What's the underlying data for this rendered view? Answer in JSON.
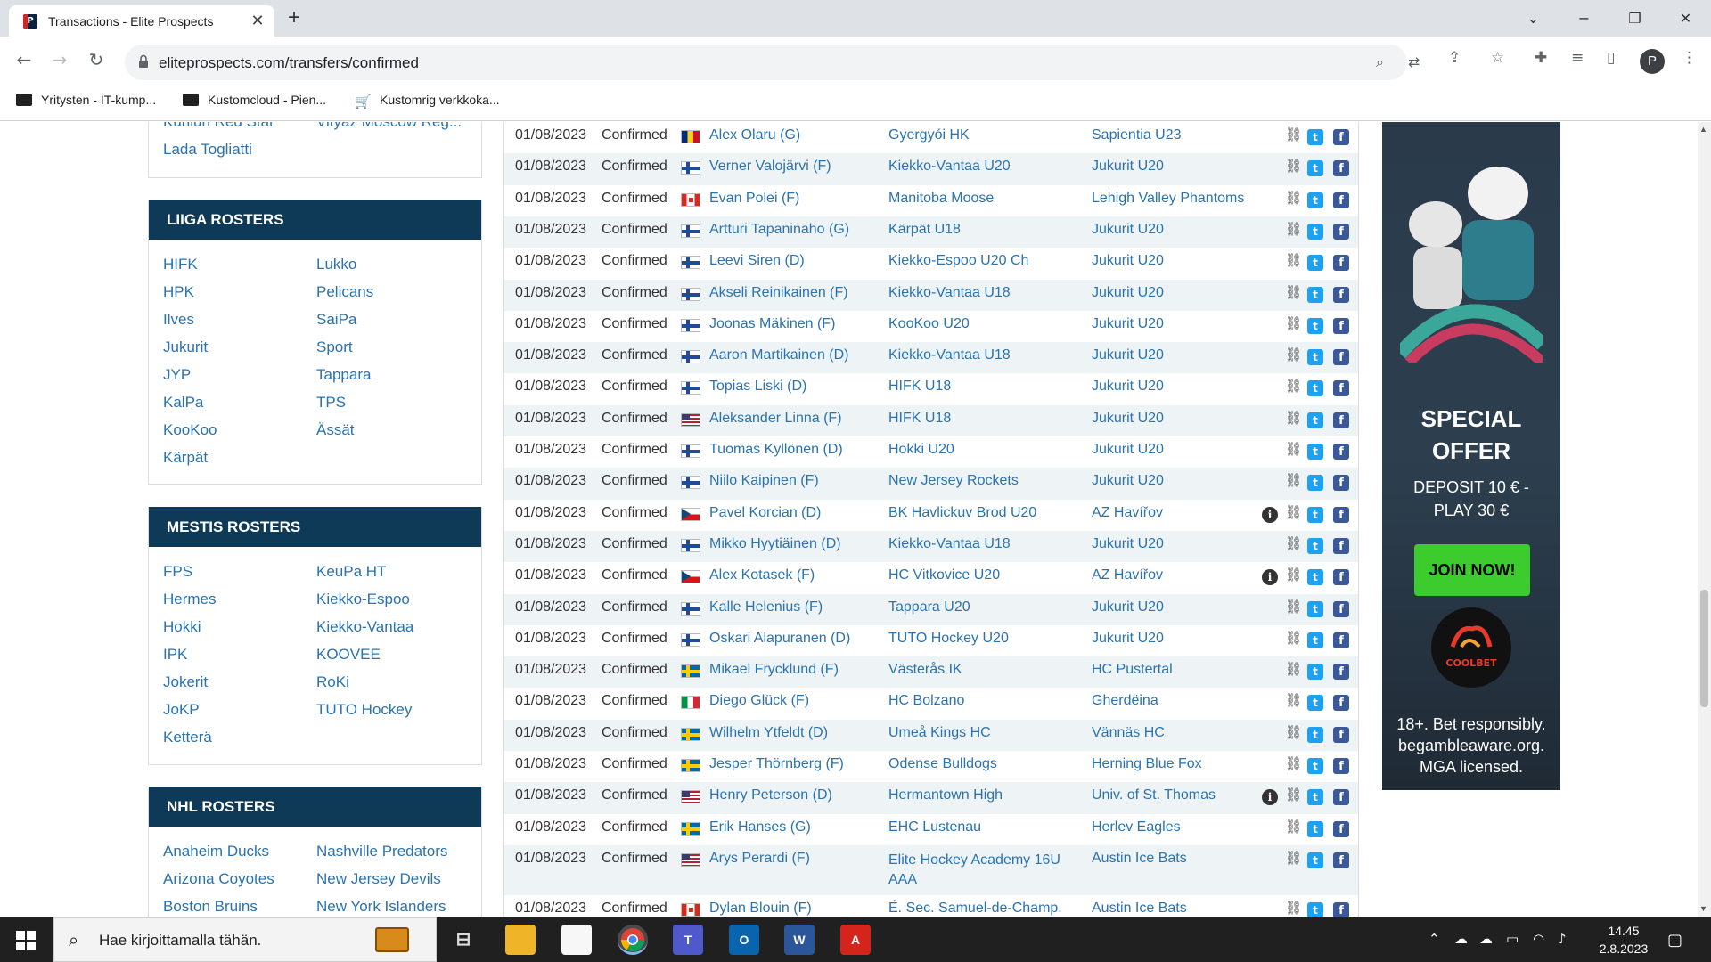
{
  "browser": {
    "tab_title": "Transactions - Elite Prospects",
    "tab_close": "✕",
    "new_tab": "+",
    "url": "eliteprospects.com/transfers/confirmed",
    "win_minimize": "⌄",
    "win_restore": "−",
    "win_maximize": "❐",
    "win_close": "✕",
    "profile_initial": "P",
    "bookmarks": [
      {
        "label": "Yritysten - IT-kump..."
      },
      {
        "label": "Kustomcloud - Pien..."
      },
      {
        "label": "Kustomrig verkkoka..."
      }
    ]
  },
  "sidebar": {
    "khl_partial": {
      "left": [
        "Kunlun Red Star",
        "Lada Togliatti"
      ],
      "right": [
        "Vityaz Moscow Reg..."
      ]
    },
    "liiga": {
      "title": "LIIGA ROSTERS",
      "left": [
        "HIFK",
        "HPK",
        "Ilves",
        "Jukurit",
        "JYP",
        "KalPa",
        "KooKoo",
        "Kärpät"
      ],
      "right": [
        "Lukko",
        "Pelicans",
        "SaiPa",
        "Sport",
        "Tappara",
        "TPS",
        "Ässät"
      ]
    },
    "mestis": {
      "title": "MESTIS ROSTERS",
      "left": [
        "FPS",
        "Hermes",
        "Hokki",
        "IPK",
        "Jokerit",
        "JoKP",
        "Ketterä"
      ],
      "right": [
        "KeuPa HT",
        "Kiekko-Espoo",
        "Kiekko-Vantaa",
        "KOOVEE",
        "RoKi",
        "TUTO Hockey"
      ]
    },
    "nhl": {
      "title": "NHL ROSTERS",
      "left": [
        "Anaheim Ducks",
        "Arizona Coyotes",
        "Boston Bruins"
      ],
      "right": [
        "Nashville Predators",
        "New Jersey Devils",
        "New York Islanders"
      ]
    }
  },
  "transfers": [
    {
      "date": "01/08/2023",
      "status": "Confirmed",
      "flag": "ro",
      "player": "Alex Olaru (G)",
      "from": "Gyergyói HK",
      "to": "Sapientia U23",
      "info": false
    },
    {
      "date": "01/08/2023",
      "status": "Confirmed",
      "flag": "fi",
      "player": "Verner Valojärvi (F)",
      "from": "Kiekko-Vantaa U20",
      "to": "Jukurit U20",
      "info": false
    },
    {
      "date": "01/08/2023",
      "status": "Confirmed",
      "flag": "ca",
      "player": "Evan Polei (F)",
      "from": "Manitoba Moose",
      "to": "Lehigh Valley Phantoms",
      "info": false
    },
    {
      "date": "01/08/2023",
      "status": "Confirmed",
      "flag": "fi",
      "player": "Artturi Tapaninaho (G)",
      "from": "Kärpät U18",
      "to": "Jukurit U20",
      "info": false
    },
    {
      "date": "01/08/2023",
      "status": "Confirmed",
      "flag": "fi",
      "player": "Leevi Siren (D)",
      "from": "Kiekko-Espoo U20 Ch",
      "to": "Jukurit U20",
      "info": false
    },
    {
      "date": "01/08/2023",
      "status": "Confirmed",
      "flag": "fi",
      "player": "Akseli Reinikainen (F)",
      "from": "Kiekko-Vantaa U18",
      "to": "Jukurit U20",
      "info": false
    },
    {
      "date": "01/08/2023",
      "status": "Confirmed",
      "flag": "fi",
      "player": "Joonas Mäkinen (F)",
      "from": "KooKoo U20",
      "to": "Jukurit U20",
      "info": false
    },
    {
      "date": "01/08/2023",
      "status": "Confirmed",
      "flag": "fi",
      "player": "Aaron Martikainen (D)",
      "from": "Kiekko-Vantaa U18",
      "to": "Jukurit U20",
      "info": false
    },
    {
      "date": "01/08/2023",
      "status": "Confirmed",
      "flag": "fi",
      "player": "Topias Liski (D)",
      "from": "HIFK U18",
      "to": "Jukurit U20",
      "info": false
    },
    {
      "date": "01/08/2023",
      "status": "Confirmed",
      "flag": "us",
      "player": "Aleksander Linna (F)",
      "from": "HIFK U18",
      "to": "Jukurit U20",
      "info": false
    },
    {
      "date": "01/08/2023",
      "status": "Confirmed",
      "flag": "fi",
      "player": "Tuomas Kyllönen (D)",
      "from": "Hokki U20",
      "to": "Jukurit U20",
      "info": false
    },
    {
      "date": "01/08/2023",
      "status": "Confirmed",
      "flag": "fi",
      "player": "Niilo Kaipinen (F)",
      "from": "New Jersey Rockets",
      "to": "Jukurit U20",
      "info": false
    },
    {
      "date": "01/08/2023",
      "status": "Confirmed",
      "flag": "cz",
      "player": "Pavel Korcian (D)",
      "from": "BK Havlickuv Brod U20",
      "to": "AZ Havířov",
      "info": true
    },
    {
      "date": "01/08/2023",
      "status": "Confirmed",
      "flag": "fi",
      "player": "Mikko Hyytiäinen (D)",
      "from": "Kiekko-Vantaa U18",
      "to": "Jukurit U20",
      "info": false
    },
    {
      "date": "01/08/2023",
      "status": "Confirmed",
      "flag": "cz",
      "player": "Alex Kotasek (F)",
      "from": "HC Vitkovice U20",
      "to": "AZ Havířov",
      "info": true
    },
    {
      "date": "01/08/2023",
      "status": "Confirmed",
      "flag": "fi",
      "player": "Kalle Helenius (F)",
      "from": "Tappara U20",
      "to": "Jukurit U20",
      "info": false
    },
    {
      "date": "01/08/2023",
      "status": "Confirmed",
      "flag": "fi",
      "player": "Oskari Alapuranen (D)",
      "from": "TUTO Hockey U20",
      "to": "Jukurit U20",
      "info": false
    },
    {
      "date": "01/08/2023",
      "status": "Confirmed",
      "flag": "se",
      "player": "Mikael Frycklund (F)",
      "from": "Västerås IK",
      "to": "HC Pustertal",
      "info": false
    },
    {
      "date": "01/08/2023",
      "status": "Confirmed",
      "flag": "it",
      "player": "Diego Glück (F)",
      "from": "HC Bolzano",
      "to": "Gherdëina",
      "info": false
    },
    {
      "date": "01/08/2023",
      "status": "Confirmed",
      "flag": "se",
      "player": "Wilhelm Ytfeldt (D)",
      "from": "Umeå Kings HC",
      "to": "Vännäs HC",
      "info": false
    },
    {
      "date": "01/08/2023",
      "status": "Confirmed",
      "flag": "se",
      "player": "Jesper Thörnberg (F)",
      "from": "Odense Bulldogs",
      "to": "Herning Blue Fox",
      "info": false
    },
    {
      "date": "01/08/2023",
      "status": "Confirmed",
      "flag": "us",
      "player": "Henry Peterson (D)",
      "from": "Hermantown High",
      "to": "Univ. of St. Thomas",
      "info": true
    },
    {
      "date": "01/08/2023",
      "status": "Confirmed",
      "flag": "se",
      "player": "Erik Hanses (G)",
      "from": "EHC Lustenau",
      "to": "Herlev Eagles",
      "info": false
    },
    {
      "date": "01/08/2023",
      "status": "Confirmed",
      "flag": "us",
      "player": "Arys Perardi (F)",
      "from": "Elite Hockey Academy 16U AAA",
      "to": "Austin Ice Bats",
      "info": false
    },
    {
      "date": "01/08/2023",
      "status": "Confirmed",
      "flag": "ca",
      "player": "Dylan Blouin (F)",
      "from": "É. Sec. Samuel-de-Champ.",
      "to": "Austin Ice Bats",
      "info": false
    }
  ],
  "ad": {
    "title_line1": "SPECIAL",
    "title_line2": "OFFER",
    "sub_line1": "DEPOSIT 10 € -",
    "sub_line2": "PLAY 30 €",
    "button": "JOIN NOW!",
    "logo": "COOLBET",
    "legal_line1": "18+. Bet responsibly.",
    "legal_line2": "begambleaware.org.",
    "legal_line3": "MGA licensed."
  },
  "taskbar": {
    "search_placeholder": "Hae kirjoittamalla tähän.",
    "time": "14.45",
    "date": "2.8.2023"
  }
}
